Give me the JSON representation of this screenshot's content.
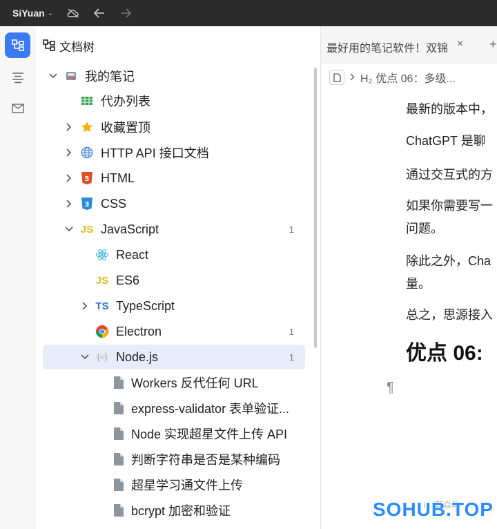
{
  "titlebar": {
    "app_name": "SiYuan",
    "app_caret": "⌄"
  },
  "dock": {
    "items": [
      "file-tree",
      "outline",
      "inbox"
    ]
  },
  "tree": {
    "header": "文档树",
    "notebook": "我的笔记",
    "items": [
      {
        "label": "代办列表",
        "icon": "task-icon"
      },
      {
        "label": "收藏置顶",
        "icon": "star-icon"
      },
      {
        "label": "HTTP API 接口文档",
        "icon": "globe-icon"
      },
      {
        "label": "HTML",
        "icon": "html5-icon"
      },
      {
        "label": "CSS",
        "icon": "css3-icon"
      },
      {
        "label": "JavaScript",
        "icon": "js-icon",
        "count": "1"
      },
      {
        "label": "React",
        "icon": "react-icon"
      },
      {
        "label": "ES6",
        "icon": "js-icon"
      },
      {
        "label": "TypeScript",
        "icon": "ts-icon"
      },
      {
        "label": "Electron",
        "icon": "chrome-icon",
        "count": "1"
      },
      {
        "label": "Node.js",
        "icon": "node-icon",
        "count": "1"
      },
      {
        "label": "Workers 反代任何 URL",
        "icon": "doc-icon"
      },
      {
        "label": "express-validator 表单验证...",
        "icon": "doc-icon"
      },
      {
        "label": "Node 实现超星文件上传 API",
        "icon": "doc-icon"
      },
      {
        "label": "判断字符串是否是某种编码",
        "icon": "doc-icon"
      },
      {
        "label": "超星学习通文件上传",
        "icon": "doc-icon"
      },
      {
        "label": "bcrypt 加密和验证",
        "icon": "doc-icon"
      }
    ],
    "glyphs": {
      "html": "5",
      "css": "3",
      "js": "JS",
      "ts": "TS",
      "node": "{○}"
    }
  },
  "editor": {
    "tab_title": "最好用的笔记软件！双锦",
    "tab_close": "×",
    "tab_plus": "+",
    "breadcrumb": "H₂ 优点 06：多级...",
    "paragraphs": [
      "最新的版本中，",
      "ChatGPT 是聊",
      "通过交互式的方",
      "如果你需要写一",
      "问题。",
      "除此之外，Cha",
      "量。",
      "总之，思源接入"
    ],
    "heading": "优点 06:",
    "pilcrow": "¶"
  },
  "watermark": {
    "text": "SOHUB.TOP",
    "small": "i...   鹤焱动"
  },
  "colors": {
    "accent": "#3a7af3",
    "selected_row": "#e6ecf8",
    "titlebar": "#2b2b2b"
  }
}
